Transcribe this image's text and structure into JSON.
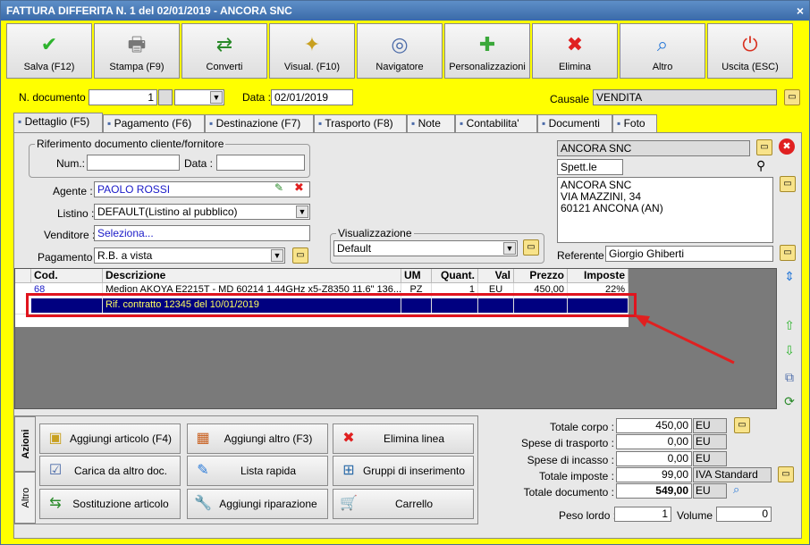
{
  "window": {
    "title": "FATTURA DIFFERITA N. 1 del 02/01/2019 - ANCORA SNC",
    "close": "×"
  },
  "toolbar": [
    {
      "label": "Salva (F12)",
      "icon": "check-icon",
      "glyph": "✔",
      "color": "#2db32d"
    },
    {
      "label": "Stampa (F9)",
      "icon": "printer-icon",
      "glyph": "🖶",
      "color": "#777777"
    },
    {
      "label": "Converti",
      "icon": "convert-icon",
      "glyph": "⇄",
      "color": "#2a8a2a"
    },
    {
      "label": "Visual. (F10)",
      "icon": "magic-wand-icon",
      "glyph": "✦",
      "color": "#c8a020"
    },
    {
      "label": "Navigatore",
      "icon": "compass-icon",
      "glyph": "◎",
      "color": "#4a6aa8"
    },
    {
      "label": "Personalizzazioni",
      "icon": "puzzle-icon",
      "glyph": "✚",
      "color": "#3aa83a"
    },
    {
      "label": "Elimina",
      "icon": "delete-icon",
      "glyph": "✖",
      "color": "#e02020"
    },
    {
      "label": "Altro",
      "icon": "magnifier-icon",
      "glyph": "⌕",
      "color": "#2a7ad8"
    },
    {
      "label": "Uscita (ESC)",
      "icon": "power-icon",
      "glyph": "⏻",
      "color": "#d83020"
    }
  ],
  "header": {
    "ndoc_label": "N. documento :",
    "ndoc_value": "1",
    "data_label": "Data :",
    "data_value": "02/01/2019",
    "causale_label": "Causale :",
    "causale_value": "VENDITA"
  },
  "tabs": [
    {
      "label": "Dettaglio (F5)",
      "icon": "detail-icon"
    },
    {
      "label": "Pagamento (F6)",
      "icon": "payment-icon"
    },
    {
      "label": "Destinazione (F7)",
      "icon": "destination-icon"
    },
    {
      "label": "Trasporto (F8)",
      "icon": "transport-icon"
    },
    {
      "label": "Note",
      "icon": "note-icon"
    },
    {
      "label": "Contabilita'",
      "icon": "accounting-icon"
    },
    {
      "label": "Documenti",
      "icon": "documents-icon"
    },
    {
      "label": "Foto",
      "icon": "photo-icon"
    }
  ],
  "riferimento": {
    "title": "Riferimento documento cliente/fornitore",
    "num_label": "Num.:",
    "data_label": "Data :"
  },
  "form": {
    "agente_label": "Agente :",
    "agente_value": "PAOLO ROSSI",
    "listino_label": "Listino :",
    "listino_value": "DEFAULT(Listino al pubblico)",
    "venditore_label": "Venditore :",
    "venditore_value": "Seleziona...",
    "pagamento_label": "Pagamento :",
    "pagamento_value": "R.B. a vista"
  },
  "visualizzazione": {
    "title": "Visualizzazione",
    "value": "Default"
  },
  "cliente": {
    "name": "ANCORA SNC",
    "salutation": "Spett.le",
    "address_lines": [
      "ANCORA SNC",
      "VIA MAZZINI, 34",
      "60121 ANCONA (AN)"
    ],
    "referente_label": "Referente",
    "referente_value": "Giorgio Ghiberti"
  },
  "grid": {
    "columns": [
      "Cod.",
      "Descrizione",
      "UM",
      "Quant.",
      "Val",
      "Prezzo",
      "Imposte"
    ],
    "rows": [
      {
        "cod": "68",
        "descrizione": "Medion AKOYA E2215T - MD 60214 1.44GHz x5-Z8350 11.6\" 136...",
        "um": "PZ",
        "quant": "1",
        "val": "EU",
        "prezzo": "450,00",
        "imposte": "22%"
      },
      {
        "cod": "",
        "descrizione": "Rif. contratto 12345 del 10/01/2019",
        "um": "",
        "quant": "",
        "val": "",
        "prezzo": "",
        "imposte": ""
      }
    ]
  },
  "actions": {
    "vtab_azioni": "Azioni",
    "vtab_altro": "Altro",
    "buttons": [
      {
        "label": "Aggiungi articolo (F4)",
        "icon": "add-item-icon",
        "glyph": "▣"
      },
      {
        "label": "Aggiungi altro (F3)",
        "icon": "add-other-icon",
        "glyph": "▦"
      },
      {
        "label": "Elimina linea",
        "icon": "delete-line-icon",
        "glyph": "✖"
      },
      {
        "label": "Carica da altro doc.",
        "icon": "load-doc-icon",
        "glyph": "☑"
      },
      {
        "label": "Lista rapida",
        "icon": "quick-list-icon",
        "glyph": "✎"
      },
      {
        "label": "Gruppi di inserimento",
        "icon": "insert-groups-icon",
        "glyph": "⊞"
      },
      {
        "label": "Sostituzione articolo",
        "icon": "replace-item-icon",
        "glyph": "⇆"
      },
      {
        "label": "Aggiungi riparazione",
        "icon": "wrench-icon",
        "glyph": "🔧"
      },
      {
        "label": "Carrello",
        "icon": "cart-icon",
        "glyph": "🛒"
      }
    ]
  },
  "totals": {
    "corpo_label": "Totale corpo :",
    "corpo_value": "450,00",
    "trasporto_label": "Spese di trasporto :",
    "trasporto_value": "0,00",
    "incasso_label": "Spese di incasso :",
    "incasso_value": "0,00",
    "imposte_label": "Totale imposte :",
    "imposte_value": "99,00",
    "imposte_unit": "IVA Standard",
    "documento_label": "Totale documento :",
    "documento_value": "549,00",
    "currency": "EU",
    "peso_label": "Peso lordo :",
    "peso_value": "1",
    "volume_label": "Volume :",
    "volume_value": "0"
  }
}
